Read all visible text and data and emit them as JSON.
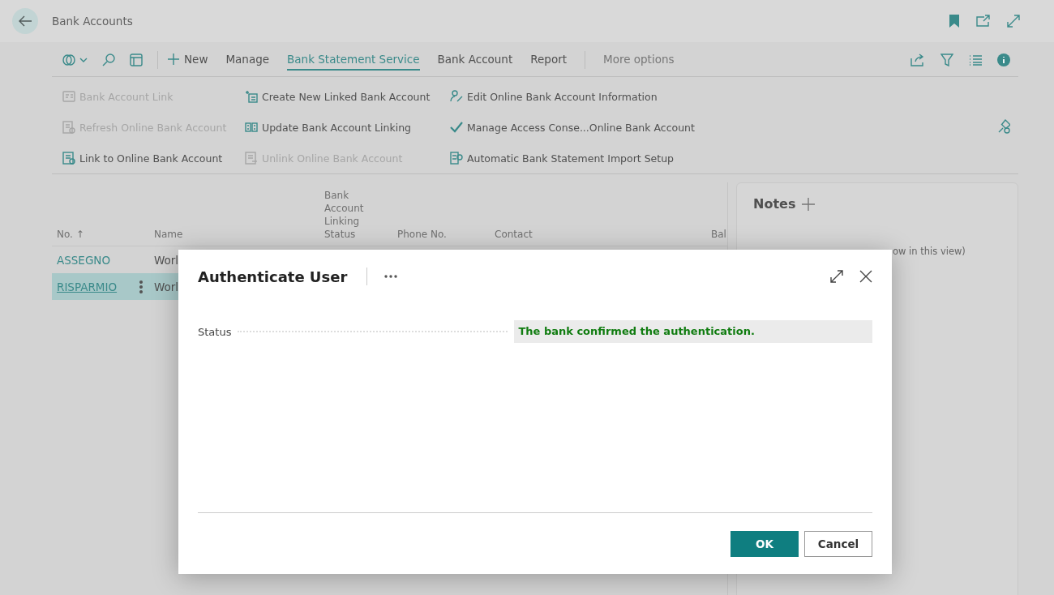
{
  "page": {
    "title": "Bank Accounts"
  },
  "action_bar": {
    "tabs": [
      {
        "label": "New",
        "kind": "new",
        "selected": false
      },
      {
        "label": "Manage",
        "kind": "menu",
        "selected": false
      },
      {
        "label": "Bank Statement Service",
        "kind": "menu",
        "selected": true
      },
      {
        "label": "Bank Account",
        "kind": "menu",
        "selected": false
      },
      {
        "label": "Report",
        "kind": "menu",
        "selected": false
      }
    ],
    "more": "More options"
  },
  "actions": [
    {
      "label": "Bank Account Link",
      "disabled": true
    },
    {
      "label": "Create New Linked Bank Account",
      "disabled": false
    },
    {
      "label": "Edit Online Bank Account Information",
      "disabled": false
    },
    {
      "label": "Refresh Online Bank Account",
      "disabled": true
    },
    {
      "label": "Update Bank Account Linking",
      "disabled": false
    },
    {
      "label": "Manage Access Conse...Online Bank Account",
      "disabled": false
    },
    {
      "label": "Link to Online Bank Account",
      "disabled": false
    },
    {
      "label": "Unlink Online Bank Account",
      "disabled": true
    },
    {
      "label": "Automatic Bank Statement Import Setup",
      "disabled": false
    }
  ],
  "list": {
    "columns": [
      "No. ↑",
      "Name",
      "Bank Account Linking Status",
      "Phone No.",
      "Contact",
      "Bal"
    ],
    "rows": [
      {
        "no": "ASSEGNO",
        "name": "Worl",
        "selected": false
      },
      {
        "no": "RISPARMIO",
        "name": "Worl",
        "selected": true
      }
    ]
  },
  "notes": {
    "title": "Notes",
    "text": "ow in this view)"
  },
  "dialog": {
    "title": "Authenticate User",
    "fields": [
      {
        "label": "Status",
        "value": "The bank confirmed the authentication."
      }
    ],
    "buttons": [
      {
        "label": "OK",
        "kind": "primary"
      },
      {
        "label": "Cancel",
        "kind": "secondary"
      }
    ]
  }
}
